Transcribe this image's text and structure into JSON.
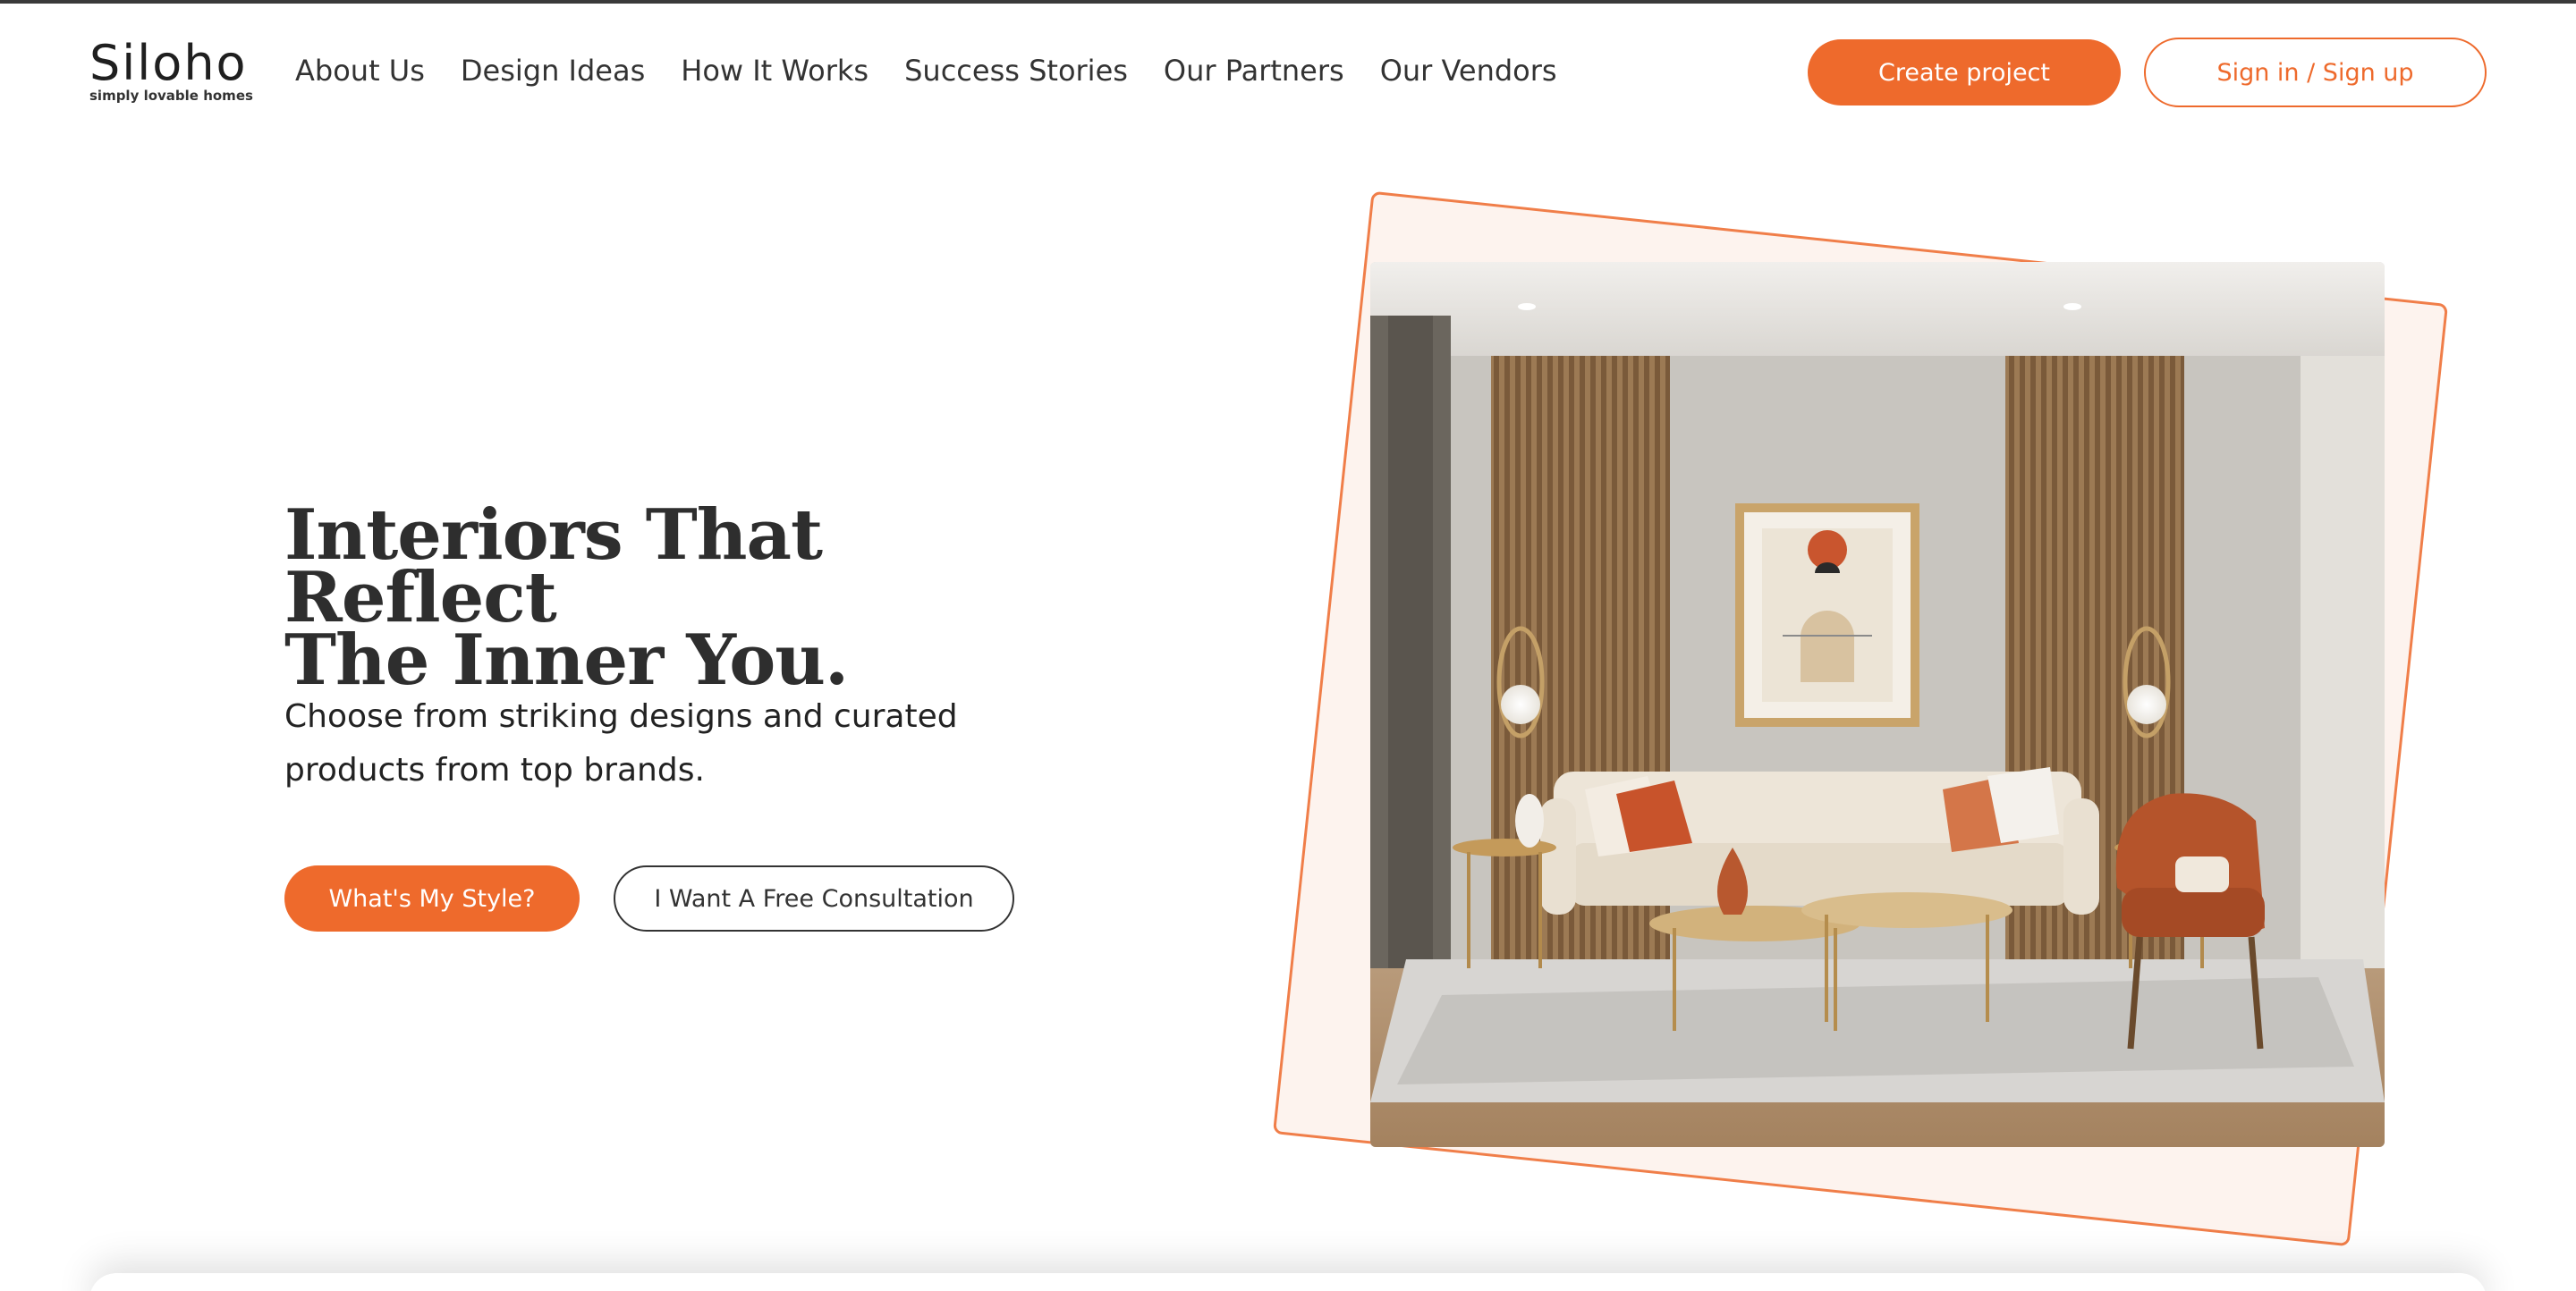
{
  "brand": {
    "name": "Siloho",
    "tagline": "simply lovable homes"
  },
  "nav": {
    "items": [
      {
        "label": "About Us"
      },
      {
        "label": "Design Ideas"
      },
      {
        "label": "How It Works"
      },
      {
        "label": "Success Stories"
      },
      {
        "label": "Our Partners"
      },
      {
        "label": "Our Vendors"
      }
    ]
  },
  "header_actions": {
    "create_label": "Create project",
    "signin_label": "Sign in / Sign up"
  },
  "hero": {
    "title_line1": "Interiors That Reflect",
    "title_line2": "The Inner You.",
    "subtitle_line1": "Choose from striking designs and curated",
    "subtitle_line2": "products from top brands.",
    "primary_cta": "What's My Style?",
    "secondary_cta": "I Want A Free Consultation"
  },
  "colors": {
    "accent": "#ee6a2c",
    "text": "#2e2e2e",
    "frame_tint": "#fdf3ee"
  }
}
